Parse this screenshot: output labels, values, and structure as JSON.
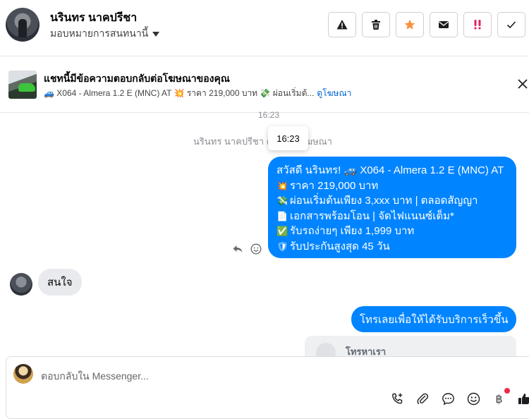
{
  "header": {
    "contact_name": "นรินทร นาคปรีชา",
    "assign_label": "มอบหมายการสนทนานี้"
  },
  "ad_banner": {
    "title": "แชทนี้มีข้อความตอบกลับต่อโฆษณาของคุณ",
    "subtitle": "🚙 X064 - Almera 1.2 E (MNC) AT 💥 ราคา 219,000 บาท 💸 ผ่อนเริ่มต้...",
    "view_ad_link": "ดูโฆษณา"
  },
  "chat": {
    "top_time": "16:23",
    "system_line": "นรินทร นาคปรีชา ตอบกลับโฆษณา",
    "tooltip_time": "16:23",
    "outgoing_ad_message": [
      {
        "emoji": "",
        "text": "สวัสดี นรินทร! 🚙 X064 - Almera 1.2 E (MNC) AT"
      },
      {
        "emoji": "💥",
        "text": "ราคา 219,000 บาท"
      },
      {
        "emoji": "💸",
        "text": "ผ่อนเริ่มต้นเพียง 3,xxx บาท | ตลอดสัญญา"
      },
      {
        "emoji": "📄",
        "text": "เอกสารพร้อมโอน | จัดไฟแนนซ์เต็ม*"
      },
      {
        "emoji": "✅",
        "text": "รับรถง่ายๆ เพียง 1,999 บาท"
      },
      {
        "emoji": "🛡",
        "text": "รับประกันสูงสุด 45 วัน"
      }
    ],
    "incoming_message": "สนใจ",
    "outgoing_call_message": "โทรเลยเพื่อให้ได้รับบริการเร็วขึ้น",
    "card_peek_text": "โทรหาเรา"
  },
  "composer": {
    "placeholder": "ตอบกลับใน Messenger..."
  },
  "colors": {
    "messenger_blue": "#0084ff",
    "star_orange": "#f7923a",
    "spam_red": "#e0245e"
  }
}
